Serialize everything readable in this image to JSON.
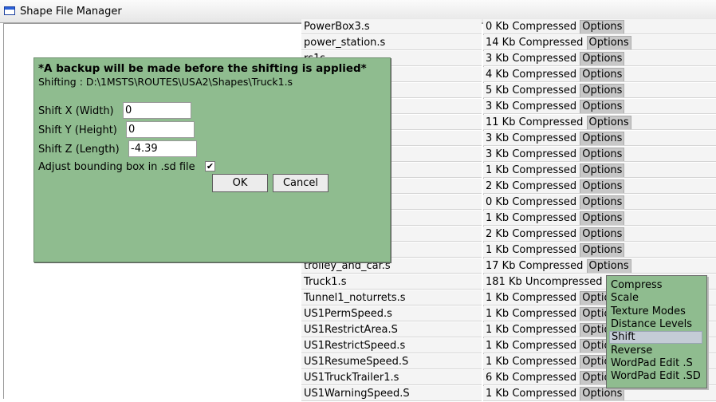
{
  "window": {
    "title": "Shape File Manager"
  },
  "files": [
    {
      "name": "PowerBox3.s",
      "size": "0 Kb Compressed",
      "options": "Options"
    },
    {
      "name": "power_station.s",
      "size": "14 Kb Compressed",
      "options": "Options"
    },
    {
      "name": "rs1s",
      "size": "3 Kb Compressed",
      "options": "Options"
    },
    {
      "name": "",
      "size": "4 Kb Compressed",
      "options": "Options"
    },
    {
      "name": "",
      "size": "5 Kb Compressed",
      "options": "Options"
    },
    {
      "name": "",
      "size": "3 Kb Compressed",
      "options": "Options"
    },
    {
      "name": "",
      "size": "11 Kb Compressed",
      "options": "Options"
    },
    {
      "name": "",
      "size": "3 Kb Compressed",
      "options": "Options"
    },
    {
      "name": "",
      "size": "3 Kb Compressed",
      "options": "Options"
    },
    {
      "name": "",
      "size": "1 Kb Compressed",
      "options": "Options"
    },
    {
      "name": "",
      "size": "2 Kb Compressed",
      "options": "Options"
    },
    {
      "name": "",
      "size": "0 Kb Compressed",
      "options": "Options"
    },
    {
      "name": "",
      "size": "1 Kb Compressed",
      "options": "Options"
    },
    {
      "name": "",
      "size": "2 Kb Compressed",
      "options": "Options"
    },
    {
      "name": "",
      "size": "1 Kb Compressed",
      "options": "Options"
    },
    {
      "name": "trolley_and_car.s",
      "size": "17 Kb Compressed",
      "options": "Options"
    },
    {
      "name": "Truck1.s",
      "size": "181 Kb Uncompressed",
      "options": ""
    },
    {
      "name": "Tunnel1_noturrets.s",
      "size": "1 Kb Compressed",
      "options": "Options"
    },
    {
      "name": "US1PermSpeed.s",
      "size": "1 Kb Compressed",
      "options": "Options"
    },
    {
      "name": "US1RestrictArea.S",
      "size": "1 Kb Compressed",
      "options": "Options"
    },
    {
      "name": "US1RestrictSpeed.s",
      "size": "1 Kb Compressed",
      "options": "Options"
    },
    {
      "name": "US1ResumeSpeed.S",
      "size": "1 Kb Compressed",
      "options": "Options"
    },
    {
      "name": "US1TruckTrailer1.s",
      "size": "6 Kb Compressed",
      "options": "Options"
    },
    {
      "name": "US1WarningSpeed.S",
      "size": "1 Kb Compressed",
      "options": "Options"
    }
  ],
  "dialog": {
    "warning": "*A backup will be made before the shifting is applied*",
    "path": "Shifting : D:\\1MSTS\\ROUTES\\USA2\\Shapes\\Truck1.s",
    "shift_x_label": "Shift X (Width)",
    "shift_x_value": "0",
    "shift_y_label": "Shift Y (Height)",
    "shift_y_value": "0",
    "shift_z_label": "Shift Z (Length)",
    "shift_z_value": "-4.39",
    "bbox_label": "Adjust bounding box in .sd file",
    "bbox_checked": "✔",
    "ok_label": "OK",
    "cancel_label": "Cancel"
  },
  "context_menu": {
    "items": [
      "Compress",
      "Scale",
      "Texture Modes",
      "Distance Levels",
      "Shift",
      "Reverse",
      "WordPad Edit .S",
      "WordPad Edit .SD"
    ],
    "selected": "Shift"
  },
  "colors": {
    "dialog_bg": "#8fbc8f",
    "row_bg": "#f4f4f4",
    "button_bg": "#c8c8c8"
  }
}
